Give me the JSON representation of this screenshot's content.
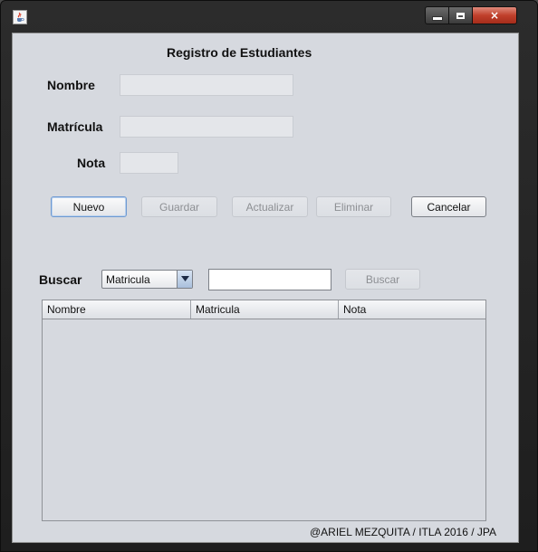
{
  "window": {
    "icon": "java-cup-icon",
    "controls": {
      "minimize": "minimize-icon",
      "maximize": "maximize-icon",
      "close": "×"
    }
  },
  "form": {
    "title": "Registro de Estudiantes",
    "labels": {
      "nombre": "Nombre",
      "matricula": "Matrícula",
      "nota": "Nota"
    },
    "values": {
      "nombre": "",
      "matricula": "",
      "nota": ""
    }
  },
  "buttons": {
    "nuevo": "Nuevo",
    "guardar": "Guardar",
    "actualizar": "Actualizar",
    "eliminar": "Eliminar",
    "cancelar": "Cancelar"
  },
  "search": {
    "label": "Buscar",
    "combo_selected": "Matricula",
    "query": "",
    "button": "Buscar"
  },
  "table": {
    "columns": [
      "Nombre",
      "Matricula",
      "Nota"
    ],
    "rows": []
  },
  "footer": "@ARIEL MEZQUITA / ITLA 2016 / JPA",
  "colors": {
    "panel": "#d6d9df",
    "close_button": "#c0402c",
    "focus_border": "#6f9ad2"
  }
}
